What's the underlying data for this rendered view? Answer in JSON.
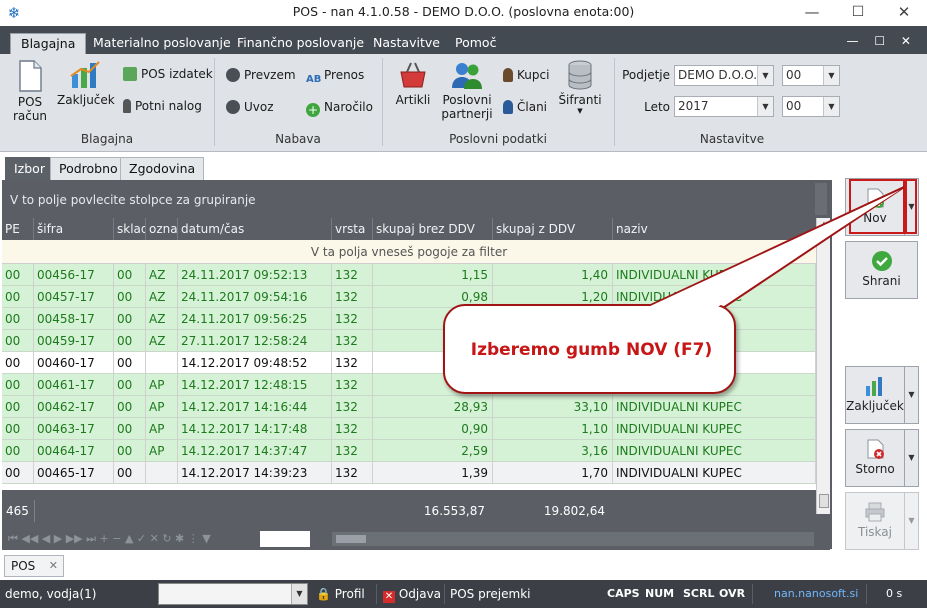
{
  "window": {
    "title": "POS - nan 4.1.0.58 - DEMO D.O.O. (poslovna enota:00)",
    "minimize": "—",
    "maximize": "☐",
    "close": "✕"
  },
  "ribbon_tabs": [
    "Blagajna",
    "Materialno poslovanje",
    "Finančno poslovanje",
    "Nastavitve",
    "Pomoč"
  ],
  "mdi_controls": "— ☐ ✕",
  "ribbon": {
    "blagajna": {
      "label": "Blagajna",
      "pos_racun": "POS\nračun",
      "zakljucek": "Zaključek",
      "pos_izdatek": "POS izdatek",
      "potni_nalog": "Potni nalog"
    },
    "nabava": {
      "label": "Nabava",
      "prevzem": "Prevzem",
      "uvoz": "Uvoz",
      "prenos": "Prenos",
      "narocilo": "Naročilo"
    },
    "poslovni": {
      "label": "Poslovni podatki",
      "artikli": "Artikli",
      "partnerji": "Poslovni\npartnerji",
      "kupci": "Kupci",
      "clani": "Člani",
      "sifranti": "Šifranti"
    },
    "nastavitve": {
      "label": "Nastavitve",
      "podjetje_label": "Podjetje",
      "podjetje_value": "DEMO D.O.O.",
      "podjetje_unit": "00",
      "leto_label": "Leto",
      "leto_value": "2017",
      "leto_unit": "00"
    }
  },
  "content_tabs": [
    "Izbor",
    "Podrobno",
    "Zgodovina"
  ],
  "grid": {
    "group_hint": "V to polje povlecite stolpce za grupiranje",
    "filter_hint": "V ta polja vneseš pogoje za filter",
    "columns": [
      "PE",
      "šifra",
      "sklad",
      "oznal",
      "datum/čas",
      "vrsta",
      "skupaj brez DDV",
      "skupaj z DDV",
      "naziv"
    ],
    "rows": [
      {
        "pe": "00",
        "sifra": "00456-17",
        "sklad": "00",
        "oznaka": "AZ",
        "datum": "24.11.2017 09:52:13",
        "vrsta": "132",
        "brez": "1,15",
        "z": "1,40",
        "naziv": "INDIVIDUALNI KUPEC",
        "style": "green"
      },
      {
        "pe": "00",
        "sifra": "00457-17",
        "sklad": "00",
        "oznaka": "AZ",
        "datum": "24.11.2017 09:54:16",
        "vrsta": "132",
        "brez": "0,98",
        "z": "1,20",
        "naziv": "INDIVIDUALNI KUPEC",
        "style": "green"
      },
      {
        "pe": "00",
        "sifra": "00458-17",
        "sklad": "00",
        "oznaka": "AZ",
        "datum": "24.11.2017 09:56:25",
        "vrsta": "132",
        "brez": "",
        "z": "",
        "naziv": "",
        "style": "green"
      },
      {
        "pe": "00",
        "sifra": "00459-17",
        "sklad": "00",
        "oznaka": "AZ",
        "datum": "27.11.2017 12:58:24",
        "vrsta": "132",
        "brez": "",
        "z": "",
        "naziv": "",
        "style": "green"
      },
      {
        "pe": "00",
        "sifra": "00460-17",
        "sklad": "00",
        "oznaka": "",
        "datum": "14.12.2017 09:48:52",
        "vrsta": "132",
        "brez": "",
        "z": "",
        "naziv": "",
        "style": "plain"
      },
      {
        "pe": "00",
        "sifra": "00461-17",
        "sklad": "00",
        "oznaka": "AP",
        "datum": "14.12.2017 12:48:15",
        "vrsta": "132",
        "brez": "",
        "z": "",
        "naziv": "",
        "style": "green"
      },
      {
        "pe": "00",
        "sifra": "00462-17",
        "sklad": "00",
        "oznaka": "AP",
        "datum": "14.12.2017 14:16:44",
        "vrsta": "132",
        "brez": "28,93",
        "z": "33,10",
        "naziv": "INDIVIDUALNI KUPEC",
        "style": "green"
      },
      {
        "pe": "00",
        "sifra": "00463-17",
        "sklad": "00",
        "oznaka": "AP",
        "datum": "14.12.2017 14:17:48",
        "vrsta": "132",
        "brez": "0,90",
        "z": "1,10",
        "naziv": "INDIVIDUALNI KUPEC",
        "style": "green"
      },
      {
        "pe": "00",
        "sifra": "00464-17",
        "sklad": "00",
        "oznaka": "AP",
        "datum": "14.12.2017 14:37:47",
        "vrsta": "132",
        "brez": "2,59",
        "z": "3,16",
        "naziv": "INDIVIDUALNI KUPEC",
        "style": "green"
      },
      {
        "pe": "00",
        "sifra": "00465-17",
        "sklad": "00",
        "oznaka": "",
        "datum": "14.12.2017 14:39:23",
        "vrsta": "132",
        "brez": "1,39",
        "z": "1,70",
        "naziv": "INDIVIDUALNI KUPEC",
        "style": "sel"
      }
    ],
    "footer": {
      "count": "465",
      "sum_brez": "16.553,87",
      "sum_z": "19.802,64"
    },
    "nav_symbols": "⏮ ◀◀ ◀ ▶ ▶▶ ⏭ + − ▲ ✓ ✕ ↻ ✱ ⋮ ▼"
  },
  "side_buttons": {
    "nov": "Nov",
    "shrani": "Shrani",
    "zakljucek": "Zaključek",
    "storno": "Storno",
    "tiskaj": "Tiskaj"
  },
  "callout": "Izberemo gumb NOV (F7)",
  "bottom_tab": {
    "label": "POS",
    "close": "✕"
  },
  "status": {
    "user": "demo, vodja(1)",
    "profil": "Profil",
    "odjava": "Odjava",
    "prejemki": "POS prejemki",
    "caps": "CAPS",
    "num": "NUM",
    "scrl": "SCRL",
    "ovr": "OVR",
    "server": "nan.nanosoft.si",
    "timer": "0 s"
  },
  "colors": {
    "accent_red": "#c61616",
    "row_green": "#d6f2d6",
    "grid_dark": "#5b5f65",
    "status_dark": "#3c4046"
  }
}
